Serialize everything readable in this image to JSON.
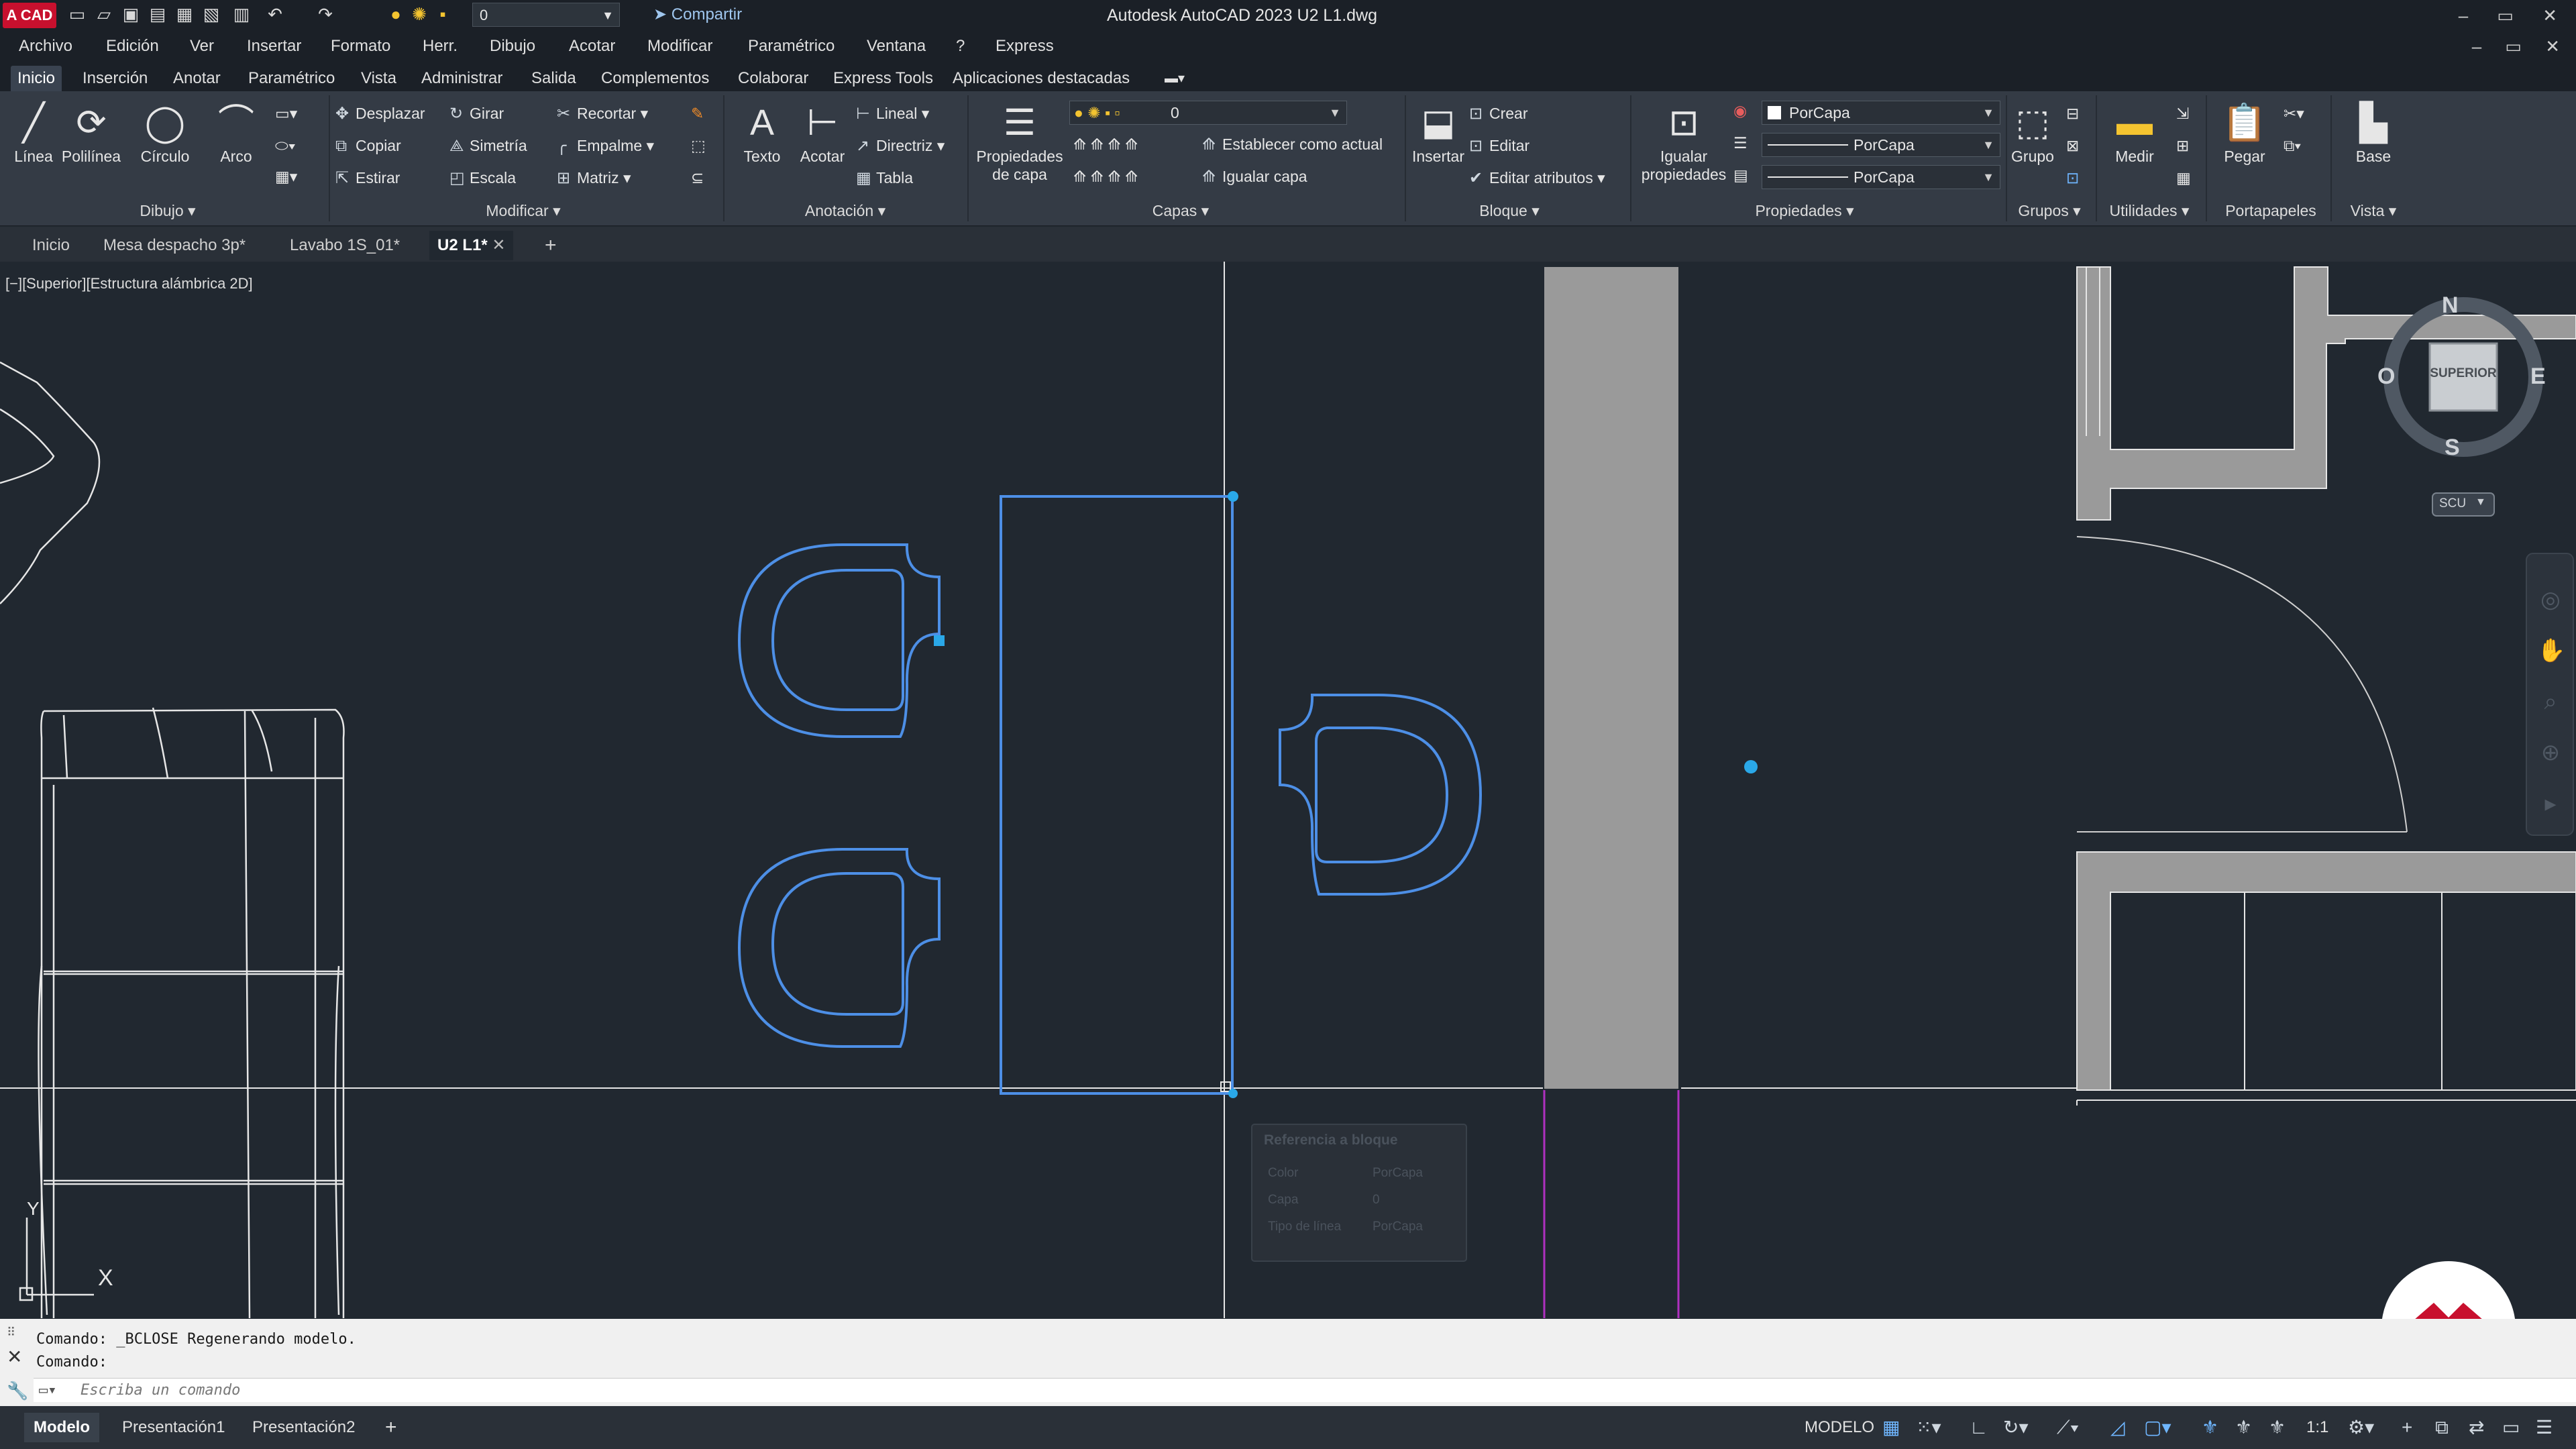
{
  "titlebar": {
    "logo": "A CAD",
    "layer_value": "0",
    "share": "Compartir",
    "title": "Autodesk AutoCAD 2023   U2 L1.dwg",
    "controls": "– ▭ ✕"
  },
  "menu": [
    "Archivo",
    "Edición",
    "Ver",
    "Insertar",
    "Formato",
    "Herr.",
    "Dibujo",
    "Acotar",
    "Modificar",
    "Paramétrico",
    "Ventana",
    "?",
    "Express"
  ],
  "ribbon_tabs": [
    "Inicio",
    "Inserción",
    "Anotar",
    "Paramétrico",
    "Vista",
    "Administrar",
    "Salida",
    "Complementos",
    "Colaborar",
    "Express Tools",
    "Aplicaciones destacadas"
  ],
  "ribbon": {
    "draw": {
      "title": "Dibujo ▾",
      "line": "Línea",
      "polyline": "Polilínea",
      "circle": "Círculo",
      "arc": "Arco"
    },
    "modify": {
      "title": "Modificar ▾",
      "move": "Desplazar",
      "rotate": "Girar",
      "trim": "Recortar",
      "copy": "Copiar",
      "mirror": "Simetría",
      "fillet": "Empalme",
      "stretch": "Estirar",
      "scale": "Escala",
      "array": "Matriz"
    },
    "annotation": {
      "title": "Anotación ▾",
      "text": "Texto",
      "dimension": "Acotar",
      "linear": "Lineal",
      "leader": "Directriz",
      "table": "Tabla"
    },
    "layers": {
      "title": "Capas ▾",
      "layer_props_1": "Propiedades",
      "layer_props_2": "de capa",
      "layer_value": "0",
      "set_current": "Establecer como actual",
      "match_layer": "Igualar capa"
    },
    "block": {
      "title": "Bloque ▾",
      "insert": "Insertar",
      "create": "Crear",
      "edit": "Editar",
      "edit_attributes": "Editar atributos"
    },
    "properties": {
      "title": "Propiedades ▾",
      "match_1": "Igualar",
      "match_2": "propiedades",
      "color": "PorCapa",
      "linetype": "PorCapa",
      "lineweight": "PorCapa"
    },
    "groups": {
      "title": "Grupos ▾",
      "group": "Grupo"
    },
    "utilities": {
      "title": "Utilidades ▾",
      "measure": "Medir"
    },
    "clipboard": {
      "title": "Portapapeles",
      "paste": "Pegar"
    },
    "view": {
      "title": "Vista ▾",
      "base": "Base"
    }
  },
  "file_tabs": [
    "Inicio",
    "Mesa despacho 3p*",
    "Lavabo 1S_01*",
    "U2 L1*"
  ],
  "viewport_label": "[−][Superior][Estructura alámbrica 2D]",
  "viewcube": {
    "n": "N",
    "s": "S",
    "e": "E",
    "w": "O",
    "face": "SUPERIOR",
    "ucs": "SCU"
  },
  "ucs_icon": {
    "y": "Y",
    "x": "X"
  },
  "tooltip": {
    "title": "Referencia a bloque",
    "row1_label": "Color",
    "row1_value": "PorCapa",
    "row2_label": "Capa",
    "row2_value": "0",
    "row3_label": "Tipo de línea",
    "row3_value": "PorCapa"
  },
  "command": {
    "line1": "Comando: _BCLOSE Regenerando modelo.",
    "line2": "Comando:",
    "placeholder": "Escriba un comando"
  },
  "status": {
    "tabs": [
      "Modelo",
      "Presentación1",
      "Presentación2"
    ],
    "model": "MODELO",
    "scale": "1:1"
  },
  "colors": {
    "canvas": "#212830",
    "selection": "#4d8fe6",
    "wall": "#9a9a9a",
    "magenta": "#b030c0",
    "grip": "#2aa8e8",
    "brand": "#c8102e"
  }
}
